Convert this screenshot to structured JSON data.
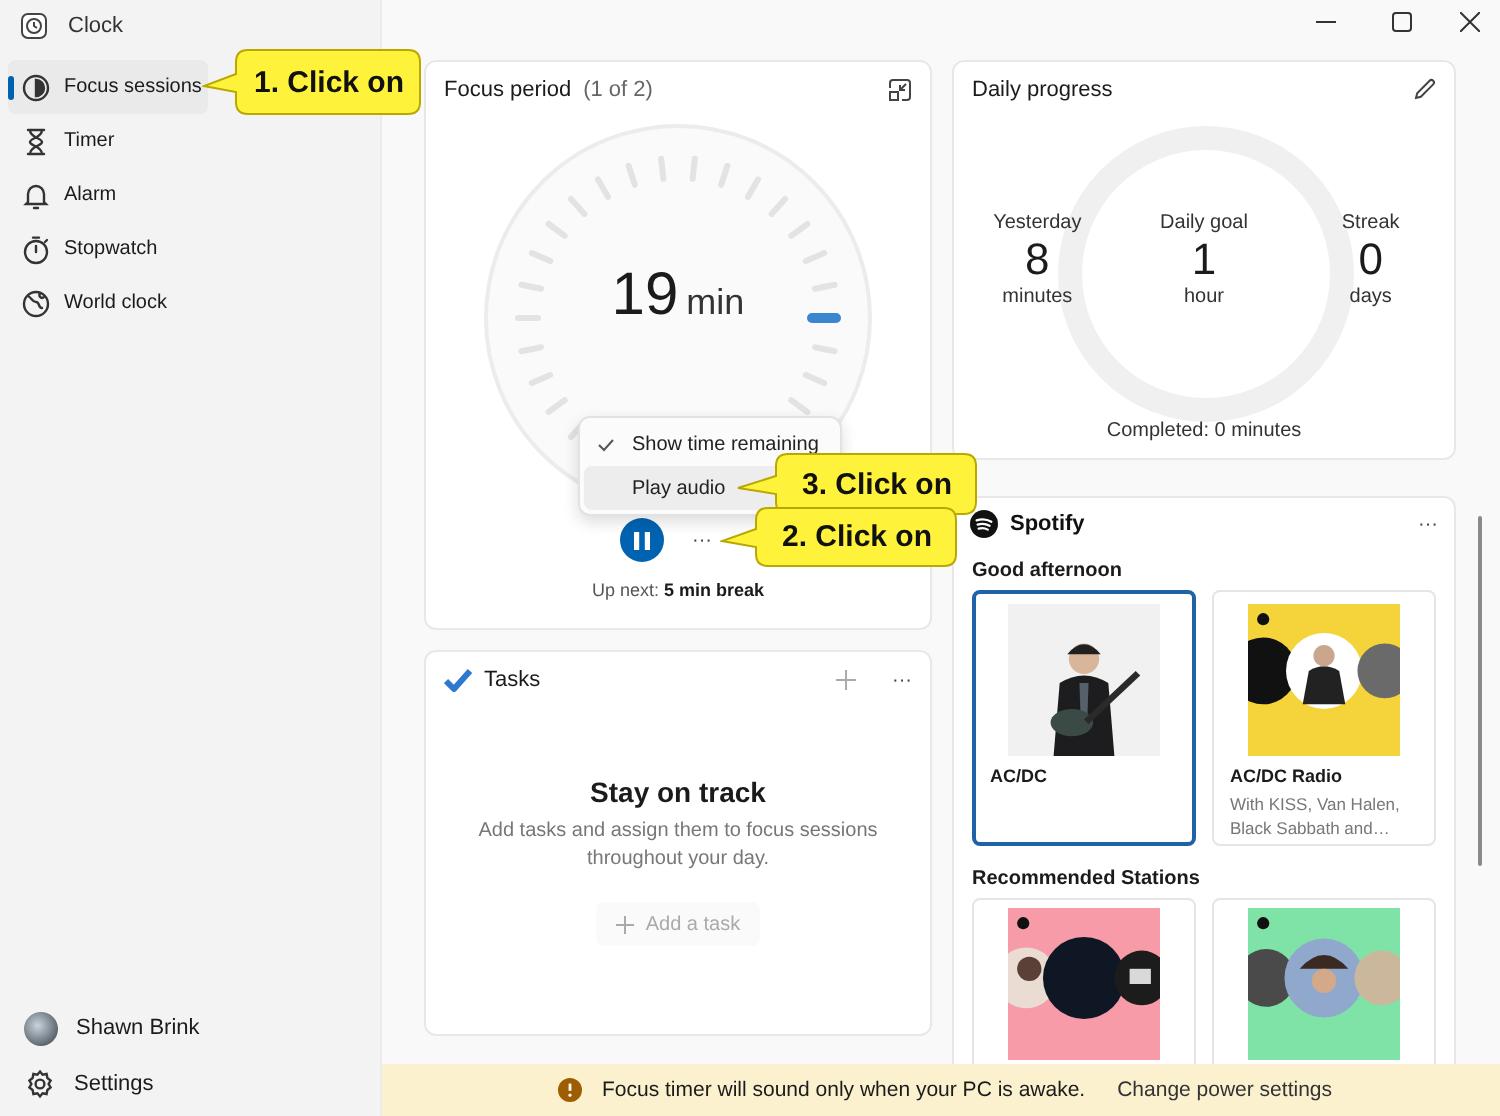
{
  "window": {
    "title": "Clock"
  },
  "nav": [
    {
      "label": "Focus sessions",
      "selected": true
    },
    {
      "label": "Timer",
      "selected": false
    },
    {
      "label": "Alarm",
      "selected": false
    },
    {
      "label": "Stopwatch",
      "selected": false
    },
    {
      "label": "World clock",
      "selected": false
    }
  ],
  "account": {
    "name": "Shawn Brink"
  },
  "settings": {
    "label": "Settings"
  },
  "focus": {
    "title": "Focus period",
    "counter": "(1 of 2)",
    "time": "19",
    "unit": "min",
    "menu": [
      {
        "label": "Show time remaining",
        "checked": true,
        "hovered": false
      },
      {
        "label": "Play audio",
        "checked": false,
        "hovered": true
      }
    ],
    "more": "···",
    "up_next": "Up next: **5 min break**"
  },
  "progress": {
    "title": "Daily progress",
    "stats": [
      {
        "label": "Yesterday",
        "value": "8",
        "unit": "minutes"
      },
      {
        "label": "Daily goal",
        "value": "1",
        "unit": "hour"
      },
      {
        "label": "Streak",
        "value": "0",
        "unit": "days"
      }
    ],
    "completed": "Completed: 0 minutes"
  },
  "tasks": {
    "title": "Tasks",
    "more": "···",
    "heading": "Stay on track",
    "text": "Add tasks and assign them to focus sessions throughout your day.",
    "add_label": "Add a task"
  },
  "spotify": {
    "title": "Spotify",
    "more": "···",
    "greeting": "Good afternoon",
    "items": [
      {
        "title": "AC/DC",
        "selected": true
      },
      {
        "title": "AC/DC Radio",
        "subtitle": "With KISS, Van Halen, Black Sabbath and…",
        "selected": false
      }
    ],
    "recommended_title": "Recommended Stations"
  },
  "notice": {
    "text": "Focus timer will sound only when your PC is awake.",
    "link": "Change power settings"
  },
  "callouts": [
    {
      "text": "1. Click on"
    },
    {
      "text": "3. Click on"
    },
    {
      "text": "2. Click on"
    }
  ]
}
